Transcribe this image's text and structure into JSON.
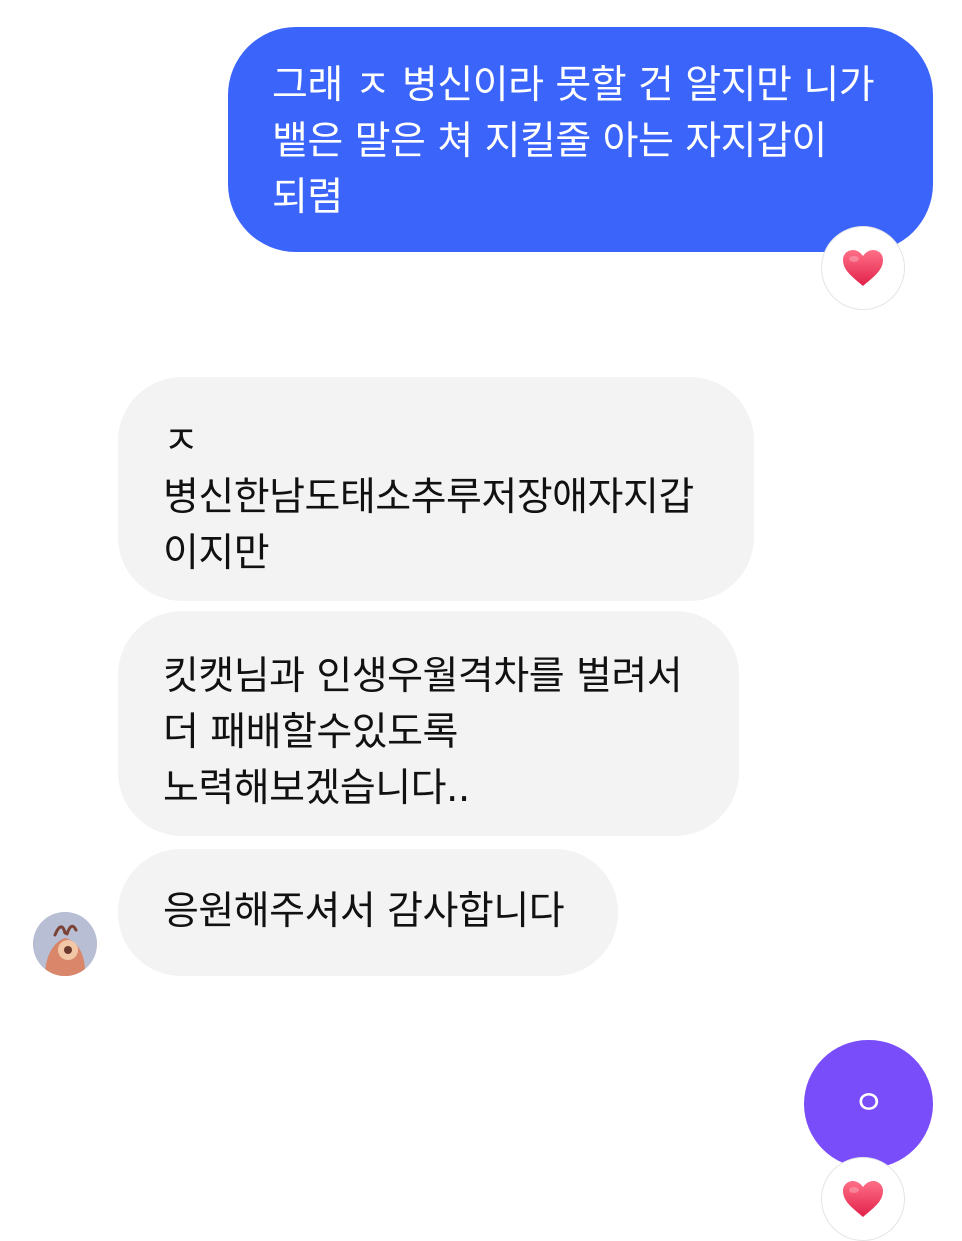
{
  "messages": [
    {
      "id": "msg1",
      "direction": "sent",
      "text": "그래 ㅈ 병신이라 못할 건 알지만 니가\n뱉은 말은 쳐 지킬줄 아는 자지갑이\n되렴",
      "reaction": "heart-icon"
    },
    {
      "id": "msg2",
      "direction": "received",
      "text": "ㅈ\n병신한남도태소추루저장애자지갑\n이지만"
    },
    {
      "id": "msg3",
      "direction": "received",
      "text": "킷캣님과 인생우월격차를 벌려서\n더 패배할수있도록\n노력해보겠습니다.."
    },
    {
      "id": "msg4",
      "direction": "received",
      "text": "응원해주셔서 감사합니다",
      "avatar": "user-avatar"
    },
    {
      "id": "msg5",
      "direction": "sent",
      "text": "ㅇ",
      "reaction": "heart-icon"
    }
  ],
  "colors": {
    "sent_bubble": "#3b64fb",
    "received_bubble": "#f3f3f3",
    "accent_bubble": "#7a4dfb",
    "heart": "#ee2e52"
  }
}
